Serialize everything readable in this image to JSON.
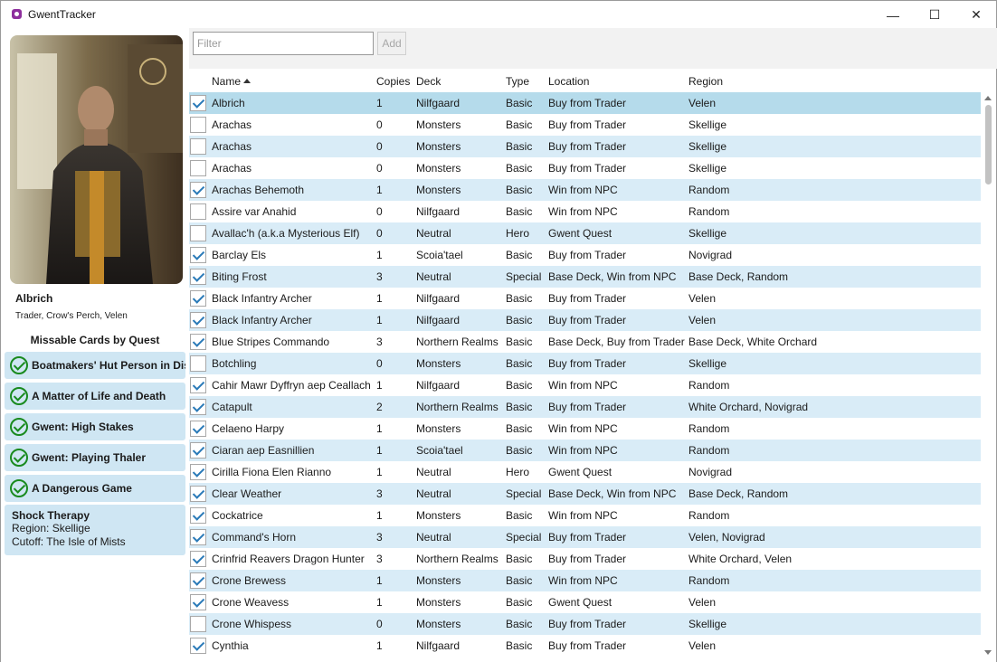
{
  "window": {
    "title": "GwentTracker",
    "minimize": "—",
    "maximize": "☐",
    "close": "✕"
  },
  "selected_card": {
    "name": "Albrich",
    "source": "Trader, Crow's Perch, Velen"
  },
  "missable": {
    "title": "Missable Cards by Quest",
    "quests": [
      "Boatmakers' Hut Person in Distress",
      "A Matter of Life and Death",
      "Gwent: High Stakes",
      "Gwent: Playing Thaler",
      "A Dangerous Game"
    ],
    "info": {
      "title": "Shock Therapy",
      "region": "Region: Skellige",
      "cutoff": "Cutoff: The Isle of Mists"
    }
  },
  "toolbar": {
    "filter_placeholder": "Filter",
    "add_label": "Add"
  },
  "grid": {
    "columns": [
      "Name",
      "Copies",
      "Deck",
      "Type",
      "Location",
      "Region"
    ],
    "sort_column": "Name",
    "rows": [
      {
        "checked": true,
        "name": "Albrich",
        "copies": "1",
        "deck": "Nilfgaard",
        "type": "Basic",
        "location": "Buy from Trader",
        "region": "Velen"
      },
      {
        "checked": false,
        "name": "Arachas",
        "copies": "0",
        "deck": "Monsters",
        "type": "Basic",
        "location": "Buy from Trader",
        "region": "Skellige"
      },
      {
        "checked": false,
        "name": "Arachas",
        "copies": "0",
        "deck": "Monsters",
        "type": "Basic",
        "location": "Buy from Trader",
        "region": "Skellige"
      },
      {
        "checked": false,
        "name": "Arachas",
        "copies": "0",
        "deck": "Monsters",
        "type": "Basic",
        "location": "Buy from Trader",
        "region": "Skellige"
      },
      {
        "checked": true,
        "name": "Arachas Behemoth",
        "copies": "1",
        "deck": "Monsters",
        "type": "Basic",
        "location": "Win from NPC",
        "region": "Random"
      },
      {
        "checked": false,
        "name": "Assire var Anahid",
        "copies": "0",
        "deck": "Nilfgaard",
        "type": "Basic",
        "location": "Win from NPC",
        "region": "Random"
      },
      {
        "checked": false,
        "name": "Avallac'h (a.k.a Mysterious Elf)",
        "copies": "0",
        "deck": "Neutral",
        "type": "Hero",
        "location": "Gwent Quest",
        "region": "Skellige"
      },
      {
        "checked": true,
        "name": "Barclay Els",
        "copies": "1",
        "deck": "Scoia'tael",
        "type": "Basic",
        "location": "Buy from Trader",
        "region": "Novigrad"
      },
      {
        "checked": true,
        "name": "Biting Frost",
        "copies": "3",
        "deck": "Neutral",
        "type": "Special",
        "location": "Base Deck, Win from NPC",
        "region": "Base Deck, Random"
      },
      {
        "checked": true,
        "name": "Black Infantry Archer",
        "copies": "1",
        "deck": "Nilfgaard",
        "type": "Basic",
        "location": "Buy from Trader",
        "region": "Velen"
      },
      {
        "checked": true,
        "name": "Black Infantry Archer",
        "copies": "1",
        "deck": "Nilfgaard",
        "type": "Basic",
        "location": "Buy from Trader",
        "region": "Velen"
      },
      {
        "checked": true,
        "name": "Blue Stripes Commando",
        "copies": "3",
        "deck": "Northern Realms",
        "type": "Basic",
        "location": "Base Deck, Buy from Trader",
        "region": "Base Deck, White Orchard"
      },
      {
        "checked": false,
        "name": "Botchling",
        "copies": "0",
        "deck": "Monsters",
        "type": "Basic",
        "location": "Buy from Trader",
        "region": "Skellige"
      },
      {
        "checked": true,
        "name": "Cahir Mawr Dyffryn aep Ceallach",
        "copies": "1",
        "deck": "Nilfgaard",
        "type": "Basic",
        "location": "Win from NPC",
        "region": "Random"
      },
      {
        "checked": true,
        "name": "Catapult",
        "copies": "2",
        "deck": "Northern Realms",
        "type": "Basic",
        "location": "Buy from Trader",
        "region": "White Orchard, Novigrad"
      },
      {
        "checked": true,
        "name": "Celaeno Harpy",
        "copies": "1",
        "deck": "Monsters",
        "type": "Basic",
        "location": "Win from NPC",
        "region": "Random"
      },
      {
        "checked": true,
        "name": "Ciaran aep Easnillien",
        "copies": "1",
        "deck": "Scoia'tael",
        "type": "Basic",
        "location": "Win from NPC",
        "region": "Random"
      },
      {
        "checked": true,
        "name": "Cirilla Fiona Elen Rianno",
        "copies": "1",
        "deck": "Neutral",
        "type": "Hero",
        "location": "Gwent Quest",
        "region": "Novigrad"
      },
      {
        "checked": true,
        "name": "Clear Weather",
        "copies": "3",
        "deck": "Neutral",
        "type": "Special",
        "location": "Base Deck, Win from NPC",
        "region": "Base Deck, Random"
      },
      {
        "checked": true,
        "name": "Cockatrice",
        "copies": "1",
        "deck": "Monsters",
        "type": "Basic",
        "location": "Win from NPC",
        "region": "Random"
      },
      {
        "checked": true,
        "name": "Command's Horn",
        "copies": "3",
        "deck": "Neutral",
        "type": "Special",
        "location": "Buy from Trader",
        "region": "Velen, Novigrad"
      },
      {
        "checked": true,
        "name": "Crinfrid Reavers Dragon Hunter",
        "copies": "3",
        "deck": "Northern Realms",
        "type": "Basic",
        "location": "Buy from Trader",
        "region": "White Orchard, Velen"
      },
      {
        "checked": true,
        "name": "Crone Brewess",
        "copies": "1",
        "deck": "Monsters",
        "type": "Basic",
        "location": "Win from NPC",
        "region": "Random"
      },
      {
        "checked": true,
        "name": "Crone Weavess",
        "copies": "1",
        "deck": "Monsters",
        "type": "Basic",
        "location": "Gwent Quest",
        "region": "Velen"
      },
      {
        "checked": false,
        "name": "Crone Whispess",
        "copies": "0",
        "deck": "Monsters",
        "type": "Basic",
        "location": "Buy from Trader",
        "region": "Skellige"
      },
      {
        "checked": true,
        "name": "Cynthia",
        "copies": "1",
        "deck": "Nilfgaard",
        "type": "Basic",
        "location": "Buy from Trader",
        "region": "Velen"
      }
    ]
  },
  "colors": {
    "row_alt": "#d9ecf7",
    "row_selected": "#b5dbeb",
    "quest_bg": "#cfe6f3",
    "check_green": "#198a1e",
    "checkbox_check": "#2a7ab8"
  }
}
